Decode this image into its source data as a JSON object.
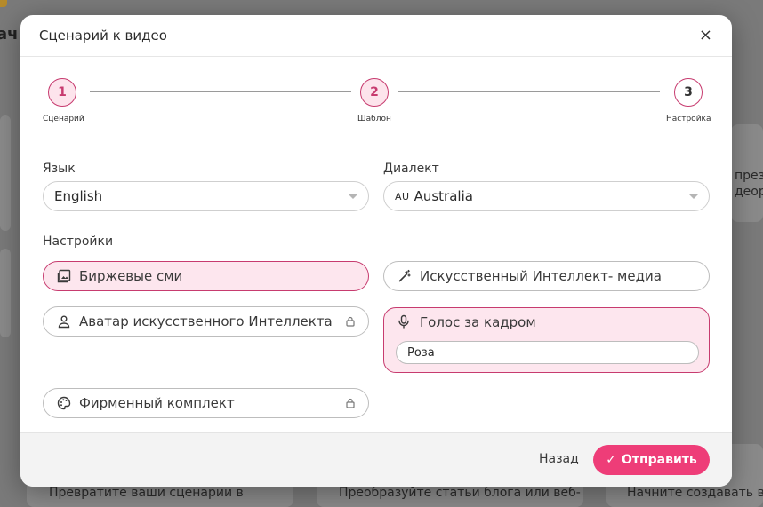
{
  "background": {
    "top_text": "ачн",
    "right_text_1": "презе",
    "right_text_2": "деоро",
    "bottom_texts": [
      "Превратите ваши сценарии в",
      "Преобразуйте статьи блога или веб-",
      "Начните создавать вид"
    ]
  },
  "modal": {
    "title": "Сценарий к видео",
    "close_symbol": "×"
  },
  "stepper": {
    "steps": [
      {
        "number": "1",
        "label": "Сценарий"
      },
      {
        "number": "2",
        "label": "Шаблон"
      },
      {
        "number": "3",
        "label": "Настройка"
      }
    ]
  },
  "language": {
    "label": "Язык",
    "value": "English"
  },
  "dialect": {
    "label": "Диалект",
    "flag_code": "AU",
    "value": "Australia"
  },
  "settings": {
    "label": "Настройки",
    "stock_media": "Биржевые сми",
    "ai_media": "Искусственный Интеллект- медиа",
    "ai_avatar": "Аватар искусственного Интеллекта",
    "voiceover": "Голос за кадром",
    "voice_name": "Роза",
    "brand_kit": "Фирменный комплект"
  },
  "footer": {
    "back_label": "Назад",
    "submit_label": "Отправить",
    "submit_icon": "✓"
  },
  "colors": {
    "accent": "#ee3d78",
    "accent_border": "#c73b6f",
    "selected_bg": "#fde6ee"
  }
}
